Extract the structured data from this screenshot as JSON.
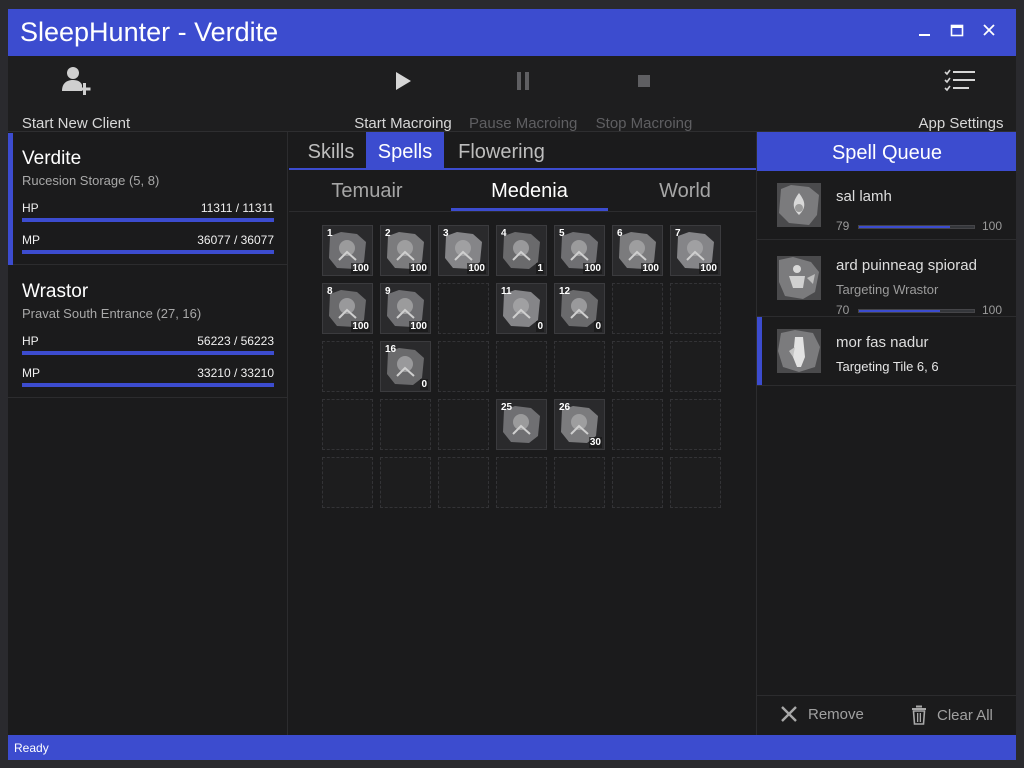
{
  "window": {
    "title": "SleepHunter - Verdite"
  },
  "toolbar": {
    "start_new_client": "Start New Client",
    "start_macroing": "Start Macroing",
    "pause_macroing": "Pause Macroing",
    "stop_macroing": "Stop Macroing",
    "app_settings": "App Settings"
  },
  "clients": [
    {
      "name": "Verdite",
      "location": "Rucesion Storage (5, 8)",
      "hp_label": "HP",
      "hp": "11311 / 11311",
      "hp_fraction": 1.0,
      "mp_label": "MP",
      "mp": "36077 / 36077",
      "mp_fraction": 1.0
    },
    {
      "name": "Wrastor",
      "location": "Pravat South Entrance (27, 16)",
      "hp_label": "HP",
      "hp": "56223 / 56223",
      "hp_fraction": 1.0,
      "mp_label": "MP",
      "mp": "33210 / 33210",
      "mp_fraction": 1.0
    }
  ],
  "tabs": {
    "skills": "Skills",
    "spells": "Spells",
    "flowering": "Flowering"
  },
  "subtabs": {
    "temuair": "Temuair",
    "medenia": "Medenia",
    "world": "World"
  },
  "spell_slots": [
    {
      "num": "1",
      "count": "100"
    },
    {
      "num": "2",
      "count": "100"
    },
    {
      "num": "3",
      "count": "100"
    },
    {
      "num": "4",
      "count": "1"
    },
    {
      "num": "5",
      "count": "100"
    },
    {
      "num": "6",
      "count": "100"
    },
    {
      "num": "7",
      "count": "100"
    },
    {
      "num": "8",
      "count": "100"
    },
    {
      "num": "9",
      "count": "100"
    },
    {
      "num": "11",
      "count": "0"
    },
    {
      "num": "12",
      "count": "0"
    },
    {
      "num": "16",
      "count": "0"
    },
    {
      "num": "25",
      "count": ""
    },
    {
      "num": "26",
      "count": "30"
    }
  ],
  "queue": {
    "header": "Spell Queue",
    "items": [
      {
        "name": "sal lamh",
        "target": "",
        "current": "79",
        "max": "100",
        "fraction": 0.79
      },
      {
        "name": "ard puinneag spiorad",
        "target": "Targeting Wrastor",
        "current": "70",
        "max": "100",
        "fraction": 0.7
      },
      {
        "name": "mor fas nadur",
        "target": "Targeting Tile 6, 6",
        "current": "",
        "max": "",
        "fraction": 0
      }
    ],
    "remove": "Remove",
    "clear_all": "Clear All"
  },
  "status": "Ready",
  "colors": {
    "accent": "#3c4ccf",
    "background": "#1b1b1c"
  }
}
